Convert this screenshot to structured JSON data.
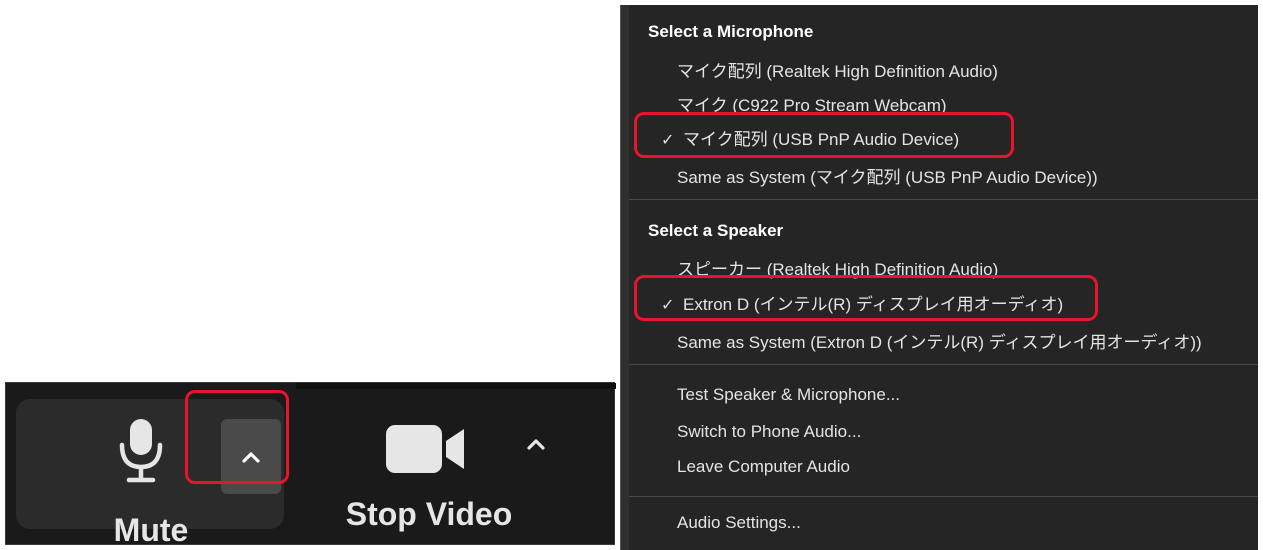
{
  "toolbar": {
    "mute_label": "Mute",
    "video_label": "Stop Video",
    "icons": [
      "microphone-icon",
      "chevron-up-icon",
      "video-camera-icon",
      "chevron-up-icon"
    ]
  },
  "menu": {
    "microphone_heading": "Select a Microphone",
    "microphones": [
      {
        "label": "マイク配列 (Realtek High Definition Audio)",
        "checked": false
      },
      {
        "label": "マイク (C922 Pro Stream Webcam)",
        "checked": false
      },
      {
        "label": "マイク配列 (USB PnP Audio Device)",
        "checked": true
      },
      {
        "label": "Same as System (マイク配列 (USB PnP Audio Device))",
        "checked": false
      }
    ],
    "speaker_heading": "Select a Speaker",
    "speakers": [
      {
        "label": "スピーカー (Realtek High Definition Audio)",
        "checked": false
      },
      {
        "label": "Extron D     (インテル(R) ディスプレイ用オーディオ)",
        "checked": true
      },
      {
        "label": "Same as System (Extron D     (インテル(R) ディスプレイ用オーディオ))",
        "checked": false
      }
    ],
    "actions": [
      "Test Speaker & Microphone...",
      "Switch to Phone Audio...",
      "Leave Computer Audio"
    ],
    "settings": "Audio Settings...",
    "check_mark": "✓"
  },
  "colors": {
    "highlight": "#e8142b",
    "menu_bg": "#252525",
    "toolbar_bg": "#1a1a1a",
    "text": "#e4e4e4"
  }
}
